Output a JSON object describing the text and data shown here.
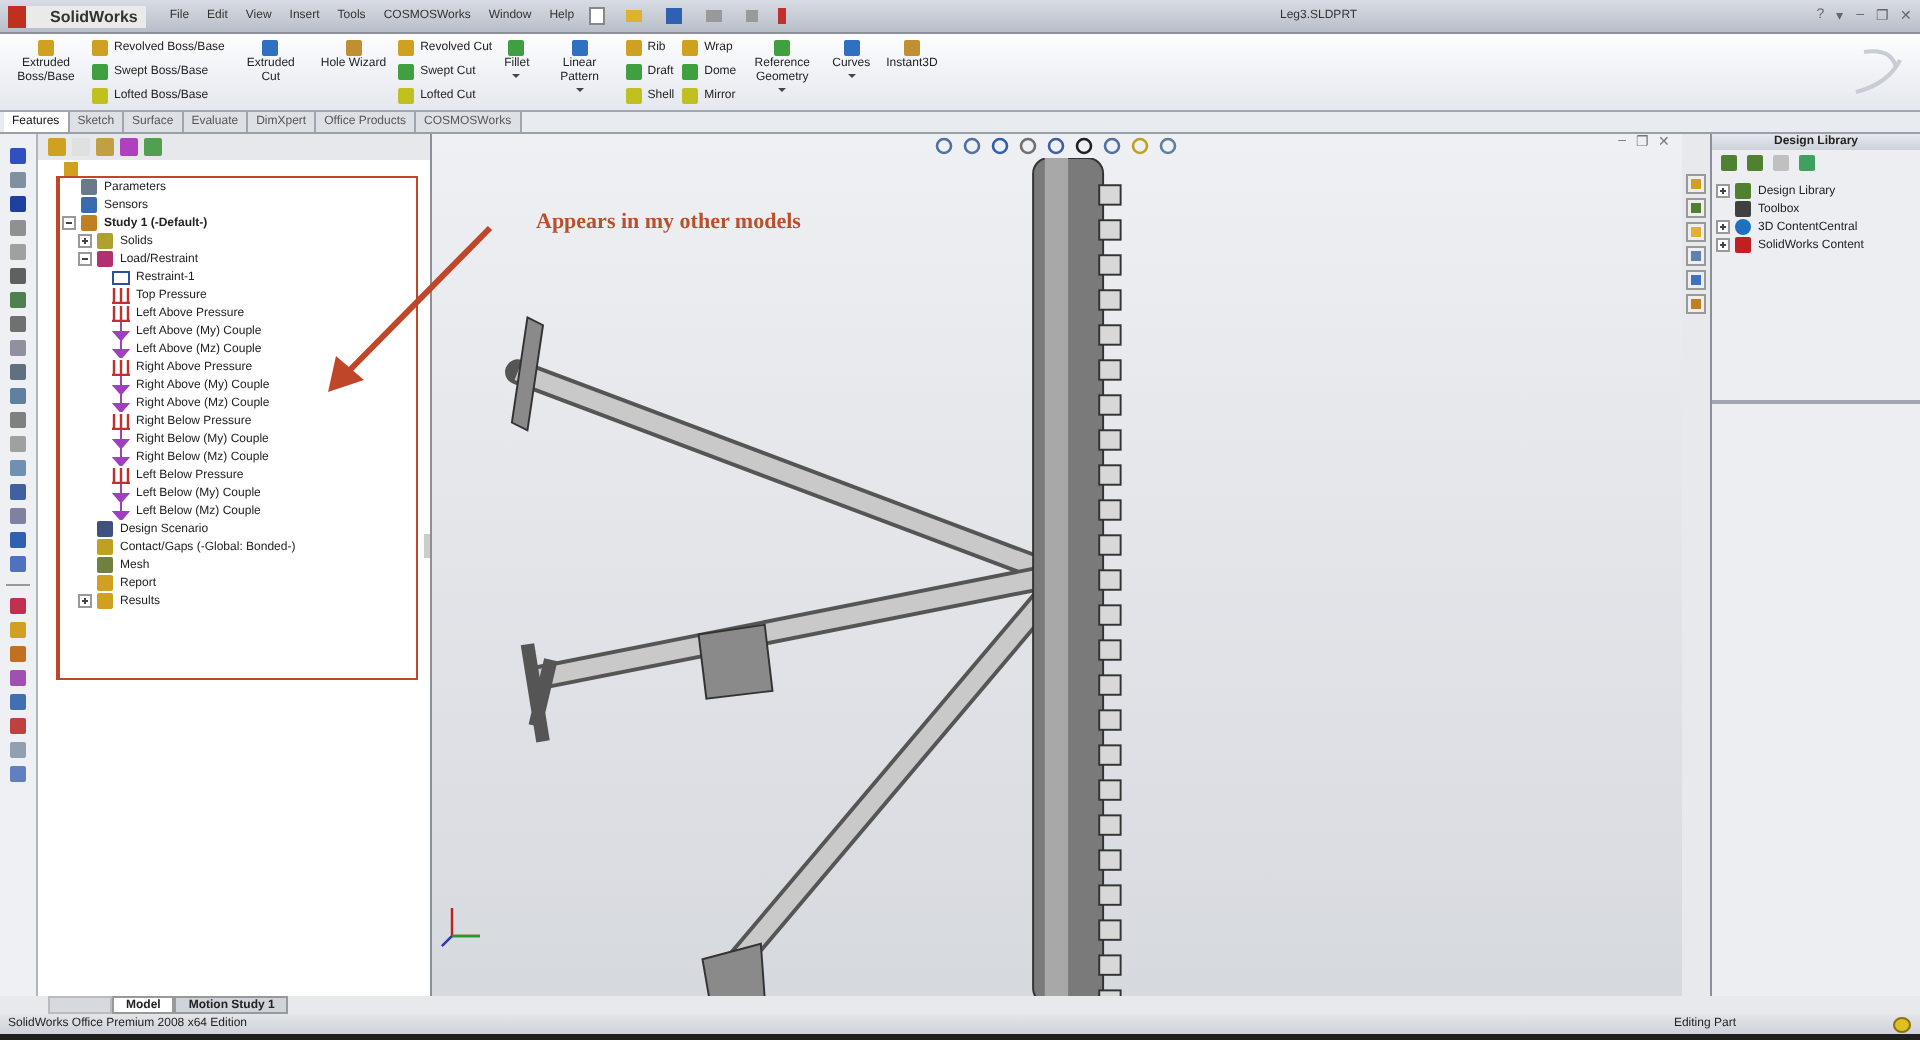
{
  "app": {
    "name": "SolidWorks",
    "menu": [
      "File",
      "Edit",
      "View",
      "Insert",
      "Tools",
      "COSMOSWorks",
      "Window",
      "Help"
    ]
  },
  "window": {
    "title": "Leg3.SLDPRT",
    "controls": [
      "?",
      "▾",
      "–",
      "❐",
      "✕"
    ]
  },
  "ribbon": [
    {
      "kind": "large",
      "label": "Extruded Boss/Base",
      "dropdown": false
    },
    {
      "kind": "stack",
      "items": [
        "Revolved Boss/Base",
        "Swept Boss/Base",
        "Lofted Boss/Base"
      ]
    },
    {
      "kind": "large",
      "label": "Extruded Cut",
      "dropdown": false
    },
    {
      "kind": "large",
      "label": "Hole Wizard",
      "dropdown": false
    },
    {
      "kind": "stack",
      "items": [
        "Revolved Cut",
        "Swept Cut",
        "Lofted Cut"
      ]
    },
    {
      "kind": "large",
      "label": "Fillet",
      "dropdown": true
    },
    {
      "kind": "large",
      "label": "Linear Pattern",
      "dropdown": true
    },
    {
      "kind": "stack",
      "items": [
        "Rib",
        "Draft",
        "Shell"
      ]
    },
    {
      "kind": "stack",
      "items": [
        "Wrap",
        "Dome",
        "Mirror"
      ]
    },
    {
      "kind": "large",
      "label": "Reference Geometry",
      "dropdown": true
    },
    {
      "kind": "large",
      "label": "Curves",
      "dropdown": true
    },
    {
      "kind": "large",
      "label": "Instant3D",
      "dropdown": false
    }
  ],
  "tabs": [
    {
      "label": "Features",
      "selected": true
    },
    {
      "label": "Sketch",
      "selected": false
    },
    {
      "label": "Surface",
      "selected": false
    },
    {
      "label": "Evaluate",
      "selected": false
    },
    {
      "label": "DimXpert",
      "selected": false
    },
    {
      "label": "Office Products",
      "selected": false
    },
    {
      "label": "COSMOSWorks",
      "selected": false
    }
  ],
  "tree": [
    {
      "label": "Parameters",
      "kind": "parameters"
    },
    {
      "label": "Sensors",
      "kind": "sensors"
    },
    {
      "label": "Study 1 (-Default-)",
      "kind": "study",
      "expanded": true,
      "children": [
        {
          "label": "Solids",
          "kind": "solids",
          "expanded": false
        },
        {
          "label": "Load/Restraint",
          "kind": "loads",
          "expanded": true,
          "children": [
            {
              "label": "Restraint-1",
              "kind": "restraint"
            },
            {
              "label": "Top Pressure",
              "kind": "pressure"
            },
            {
              "label": "Left Above Pressure",
              "kind": "pressure"
            },
            {
              "label": "Left Above (My) Couple",
              "kind": "couple"
            },
            {
              "label": "Left Above (Mz) Couple",
              "kind": "couple"
            },
            {
              "label": "Right Above Pressure",
              "kind": "pressure"
            },
            {
              "label": "Right Above (My) Couple",
              "kind": "couple"
            },
            {
              "label": "Right Above (Mz) Couple",
              "kind": "couple"
            },
            {
              "label": "Right Below Pressure",
              "kind": "pressure"
            },
            {
              "label": "Right Below (My) Couple",
              "kind": "couple"
            },
            {
              "label": "Right Below (Mz) Couple",
              "kind": "couple"
            },
            {
              "label": "Left Below Pressure",
              "kind": "pressure"
            },
            {
              "label": "Left Below (My) Couple",
              "kind": "couple"
            },
            {
              "label": "Left Below (Mz) Couple",
              "kind": "couple"
            }
          ]
        },
        {
          "label": "Design Scenario",
          "kind": "scenario"
        },
        {
          "label": "Contact/Gaps (-Global: Bonded-)",
          "kind": "contact"
        },
        {
          "label": "Mesh",
          "kind": "mesh"
        },
        {
          "label": "Report",
          "kind": "report"
        },
        {
          "label": "Results",
          "kind": "results",
          "expanded": false
        }
      ]
    }
  ],
  "annotation": {
    "text": "Appears in my other models"
  },
  "viewport": {
    "controls": [
      "–",
      "❐",
      "✕"
    ]
  },
  "design_library": {
    "title": "Design Library",
    "items": [
      {
        "label": "Design Library",
        "kind": "library",
        "expanded": false
      },
      {
        "label": "Toolbox",
        "kind": "toolbox"
      },
      {
        "label": "3D ContentCentral",
        "kind": "globe",
        "expanded": false
      },
      {
        "label": "SolidWorks Content",
        "kind": "content",
        "expanded": false
      }
    ]
  },
  "bottom_tabs": [
    {
      "label": "Model",
      "selected": true
    },
    {
      "label": "Motion Study 1",
      "selected": false
    }
  ],
  "status_bar": {
    "left": "SolidWorks Office Premium 2008 x64 Edition",
    "right": "Editing Part"
  }
}
